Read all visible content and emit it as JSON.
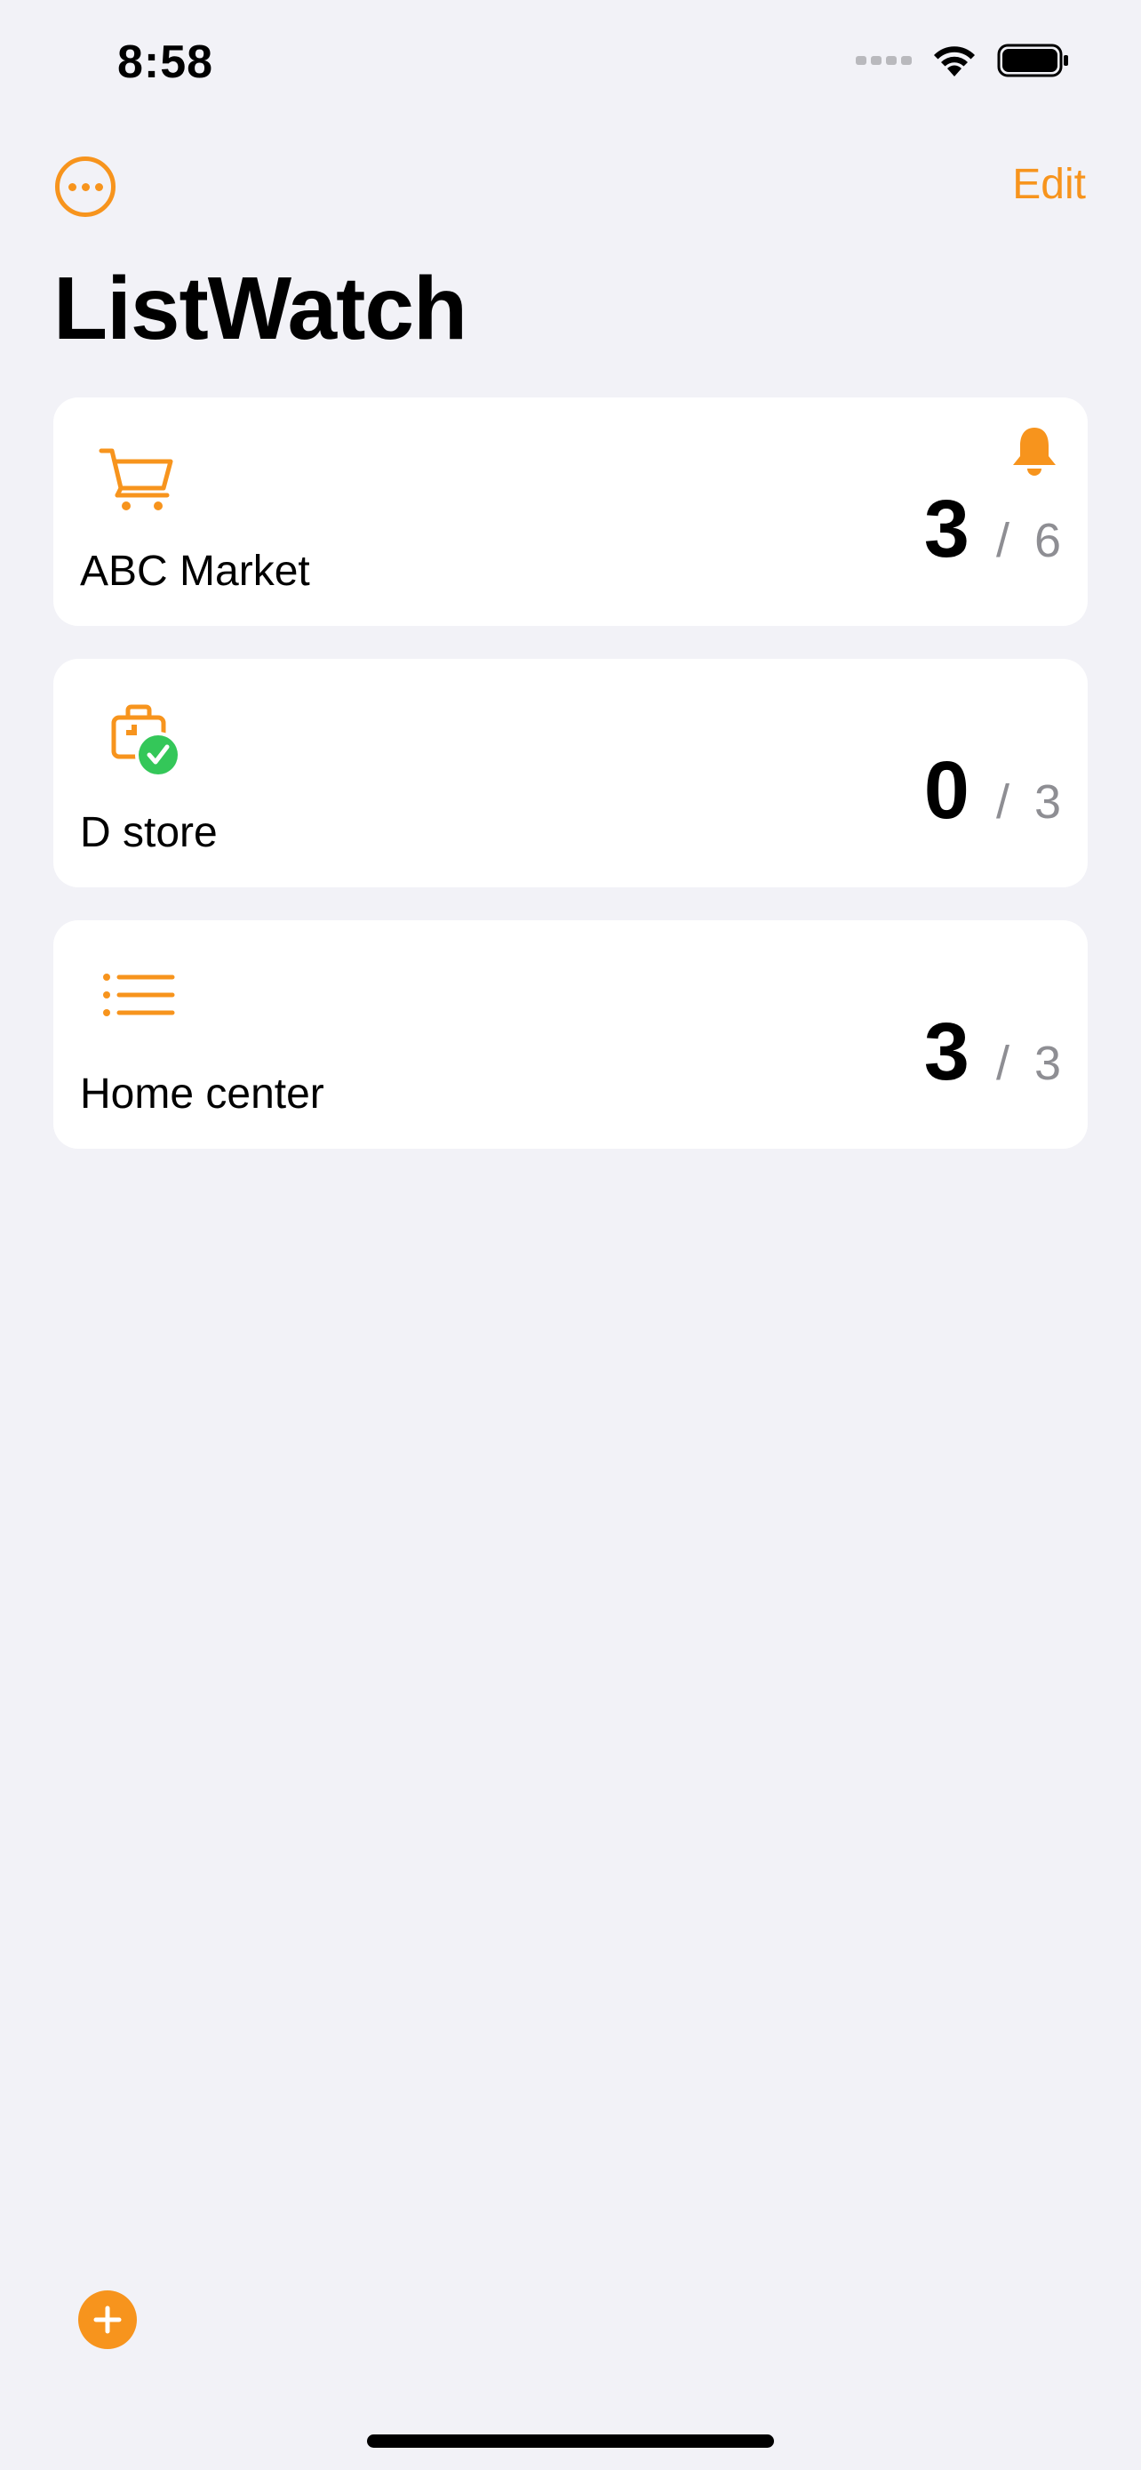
{
  "status_bar": {
    "time": "8:58"
  },
  "nav": {
    "edit_label": "Edit",
    "more_icon": "ellipsis-circle-icon"
  },
  "page": {
    "title": "ListWatch"
  },
  "lists": [
    {
      "name": "ABC Market",
      "done": "3",
      "separator": "/",
      "total": "6",
      "icon": "cart-icon",
      "has_alert": true
    },
    {
      "name": "D store",
      "done": "0",
      "separator": "/",
      "total": "3",
      "icon": "bag-check-icon",
      "has_alert": false
    },
    {
      "name": "Home center",
      "done": "3",
      "separator": "/",
      "total": "3",
      "icon": "list-icon",
      "has_alert": false
    }
  ],
  "colors": {
    "accent": "#F7941D",
    "check_badge": "#34C759",
    "secondary_text": "#8E8E93",
    "background": "#F2F2F7"
  },
  "footer": {
    "add_icon": "plus-circle-icon"
  }
}
